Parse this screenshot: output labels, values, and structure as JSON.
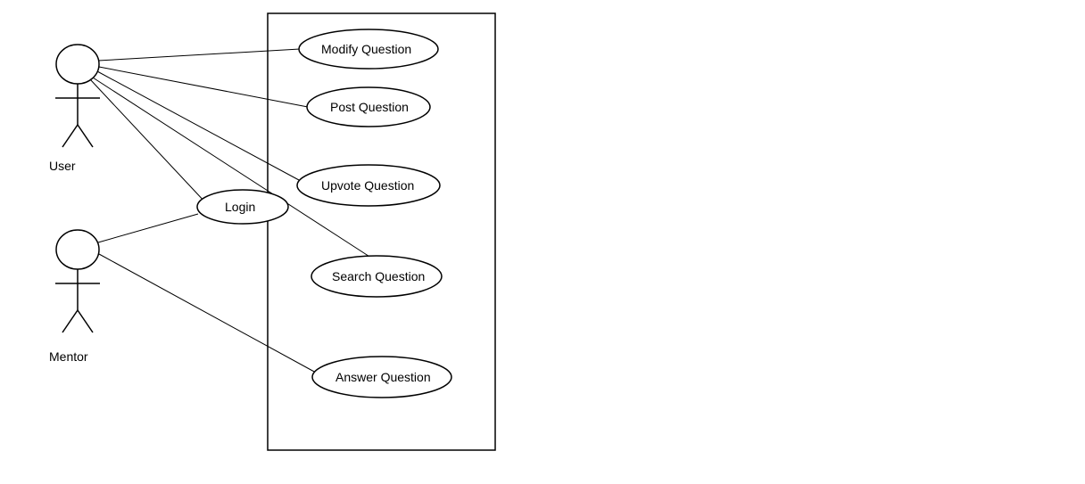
{
  "actors": {
    "user": {
      "label": "User"
    },
    "mentor": {
      "label": "Mentor"
    }
  },
  "usecases": {
    "login": {
      "label": "Login"
    },
    "modify": {
      "label": "Modify Question"
    },
    "post": {
      "label": "Post Question"
    },
    "upvote": {
      "label": "Upvote Question"
    },
    "search": {
      "label": "Search Question"
    },
    "answer": {
      "label": "Answer Question"
    }
  }
}
